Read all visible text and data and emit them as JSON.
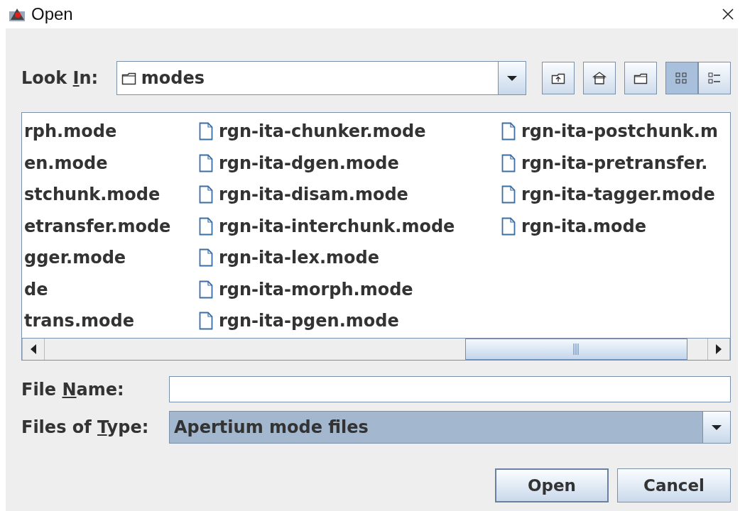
{
  "window": {
    "title": "Open"
  },
  "look_in": {
    "label": {
      "before": "Look ",
      "key": "I",
      "after": "n:"
    },
    "value": "modes"
  },
  "toolbar": [
    {
      "kind": "up",
      "selected": false
    },
    {
      "kind": "home",
      "selected": false
    },
    {
      "kind": "new-folder",
      "selected": false
    },
    {
      "kind": "list",
      "selected": true
    },
    {
      "kind": "details",
      "selected": false
    }
  ],
  "file_list": {
    "columns": [
      {
        "icons_hidden": true,
        "items": [
          "rph.mode",
          "en.mode",
          "stchunk.mode",
          "etransfer.mode",
          "gger.mode",
          "de",
          "trans.mode"
        ]
      },
      {
        "icons_hidden": false,
        "items": [
          "rgn-ita-chunker.mode",
          "rgn-ita-dgen.mode",
          "rgn-ita-disam.mode",
          "rgn-ita-interchunk.mode",
          "rgn-ita-lex.mode",
          "rgn-ita-morph.mode",
          "rgn-ita-pgen.mode"
        ]
      },
      {
        "icons_hidden": false,
        "items": [
          "rgn-ita-postchunk.m",
          "rgn-ita-pretransfer.",
          "rgn-ita-tagger.mode",
          "rgn-ita.mode"
        ]
      }
    ]
  },
  "file_name": {
    "label": {
      "before": "File ",
      "key": "N",
      "after": "ame:"
    }
  },
  "file_type": {
    "label": {
      "before": "Files of ",
      "key": "T",
      "after": "ype:"
    },
    "value": "Apertium mode files"
  },
  "buttons": [
    {
      "label": "Open",
      "kind": "default"
    },
    {
      "label": "Cancel",
      "kind": "normal"
    }
  ]
}
